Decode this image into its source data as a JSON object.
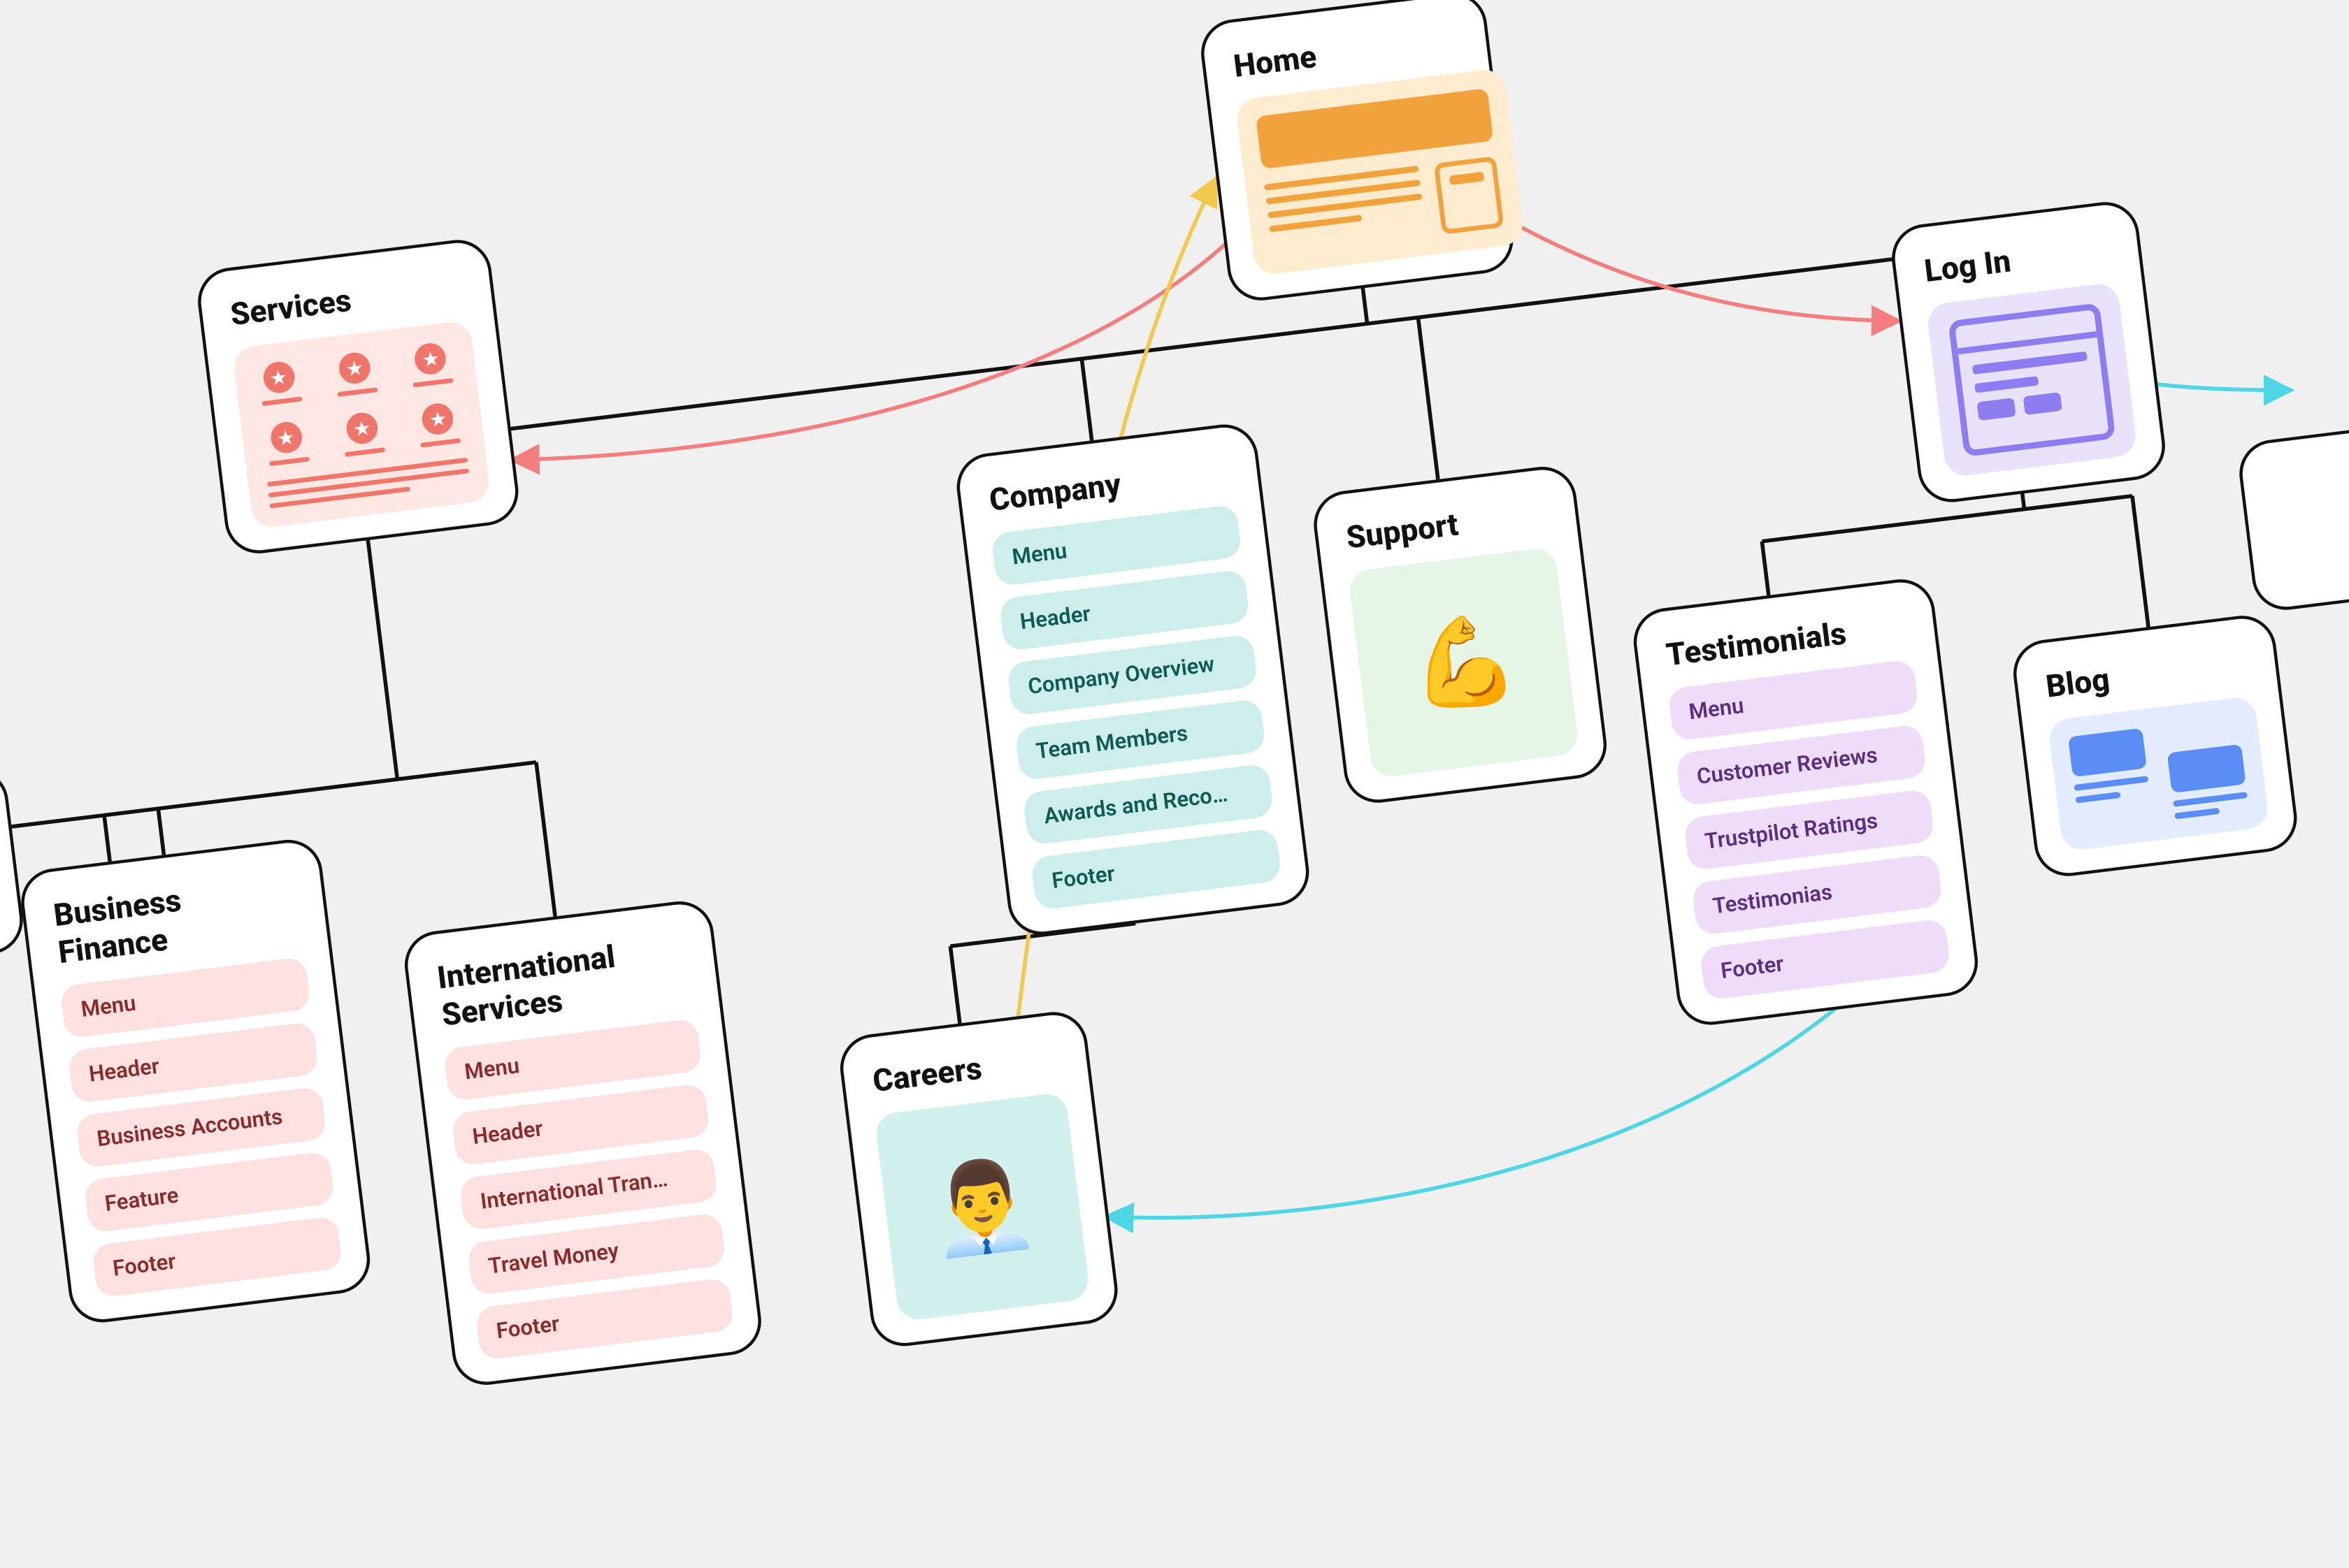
{
  "nodes": {
    "home": {
      "title": "Home"
    },
    "services": {
      "title": "Services"
    },
    "login": {
      "title": "Log In"
    },
    "company": {
      "title": "Company",
      "sections": [
        "Menu",
        "Header",
        "Company Overview",
        "Team Members",
        "Awards and Reco…",
        "Footer"
      ]
    },
    "support": {
      "title": "Support",
      "emoji": "💪"
    },
    "testimonials": {
      "title": "Testimonials",
      "sections": [
        "Menu",
        "Customer Reviews",
        "Trustpilot Ratings",
        "Testimonias",
        "Footer"
      ]
    },
    "blog": {
      "title": "Blog"
    },
    "business": {
      "title_line1": "Business",
      "title_line2": "Finance",
      "sections": [
        "Menu",
        "Header",
        "Business Accounts",
        "Feature",
        "Footer"
      ]
    },
    "intl": {
      "title_line1": "International",
      "title_line2": "Services",
      "sections": [
        "Menu",
        "Header",
        "International Tran…",
        "Travel Money",
        "Footer"
      ]
    },
    "careers": {
      "title": "Careers",
      "emoji": "👨‍💼"
    }
  },
  "connectors": [
    {
      "from": "home",
      "to": "services",
      "type": "tree",
      "color": "#111"
    },
    {
      "from": "home",
      "to": "company",
      "type": "tree",
      "color": "#111"
    },
    {
      "from": "home",
      "to": "support",
      "type": "tree",
      "color": "#111"
    },
    {
      "from": "home",
      "to": "login",
      "type": "tree",
      "color": "#111"
    },
    {
      "from": "services",
      "to": "business",
      "type": "tree",
      "color": "#111"
    },
    {
      "from": "services",
      "to": "intl",
      "type": "tree",
      "color": "#111"
    },
    {
      "from": "company",
      "to": "careers",
      "type": "tree",
      "color": "#111"
    },
    {
      "from": "login",
      "to": "testimonials",
      "type": "tree",
      "color": "#111"
    },
    {
      "from": "login",
      "to": "blog",
      "type": "tree",
      "color": "#111"
    },
    {
      "from": "home",
      "to": "services",
      "type": "curve",
      "color": "#f47d7d",
      "arrow": "end-to-from"
    },
    {
      "from": "home",
      "to": "login",
      "type": "curve",
      "color": "#f47d7d",
      "arrow": "end-to-to"
    },
    {
      "from": "careers",
      "to": "home",
      "type": "curve",
      "color": "#f3c84b",
      "arrow": "end-to-to"
    },
    {
      "from": "testimonials",
      "to": "careers",
      "type": "curve",
      "color": "#4fd6e5",
      "arrow": "end-to-to"
    },
    {
      "from": "login",
      "to": "offpage-right",
      "type": "curve",
      "color": "#4fd6e5",
      "arrow": "end-to-to"
    }
  ]
}
